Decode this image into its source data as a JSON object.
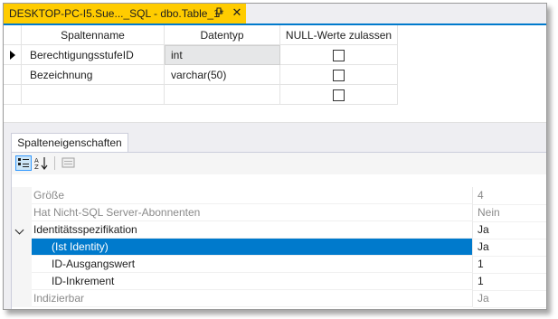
{
  "window": {
    "tab_title": "DESKTOP-PC-I5.Sue..._SQL - dbo.Table_1*",
    "close_glyph": "✕"
  },
  "grid": {
    "headers": [
      "Spaltenname",
      "Datentyp",
      "NULL-Werte zulassen"
    ],
    "rows": [
      {
        "name": "BerechtigungsstufeID",
        "type": "int",
        "allow_null": false,
        "current": true
      },
      {
        "name": "Bezeichnung",
        "type": "varchar(50)",
        "allow_null": false,
        "current": false
      },
      {
        "name": "",
        "type": "",
        "allow_null": false,
        "current": false
      }
    ]
  },
  "properties": {
    "tab_label": "Spalteneigenschaften",
    "toolbar": {
      "categorized_icon": "categorized-icon",
      "alphabetical_icon": "sort-az-icon",
      "pages_icon": "property-pages-icon"
    },
    "rows": [
      {
        "name": "Größe",
        "value": "4",
        "muted": true,
        "level": 0
      },
      {
        "name": "Hat Nicht-SQL Server-Abonnenten",
        "value": "Nein",
        "muted": true,
        "level": 0
      },
      {
        "name": "Identitätsspezifikation",
        "value": "Ja",
        "muted": false,
        "level": 0,
        "expanded": true
      },
      {
        "name": "(Ist Identity)",
        "value": "Ja",
        "muted": false,
        "level": 1,
        "selected": true
      },
      {
        "name": "ID-Ausgangswert",
        "value": "1",
        "muted": false,
        "level": 1
      },
      {
        "name": "ID-Inkrement",
        "value": "1",
        "muted": false,
        "level": 1
      },
      {
        "name": "Indizierbar",
        "value": "Ja",
        "muted": true,
        "level": 0
      }
    ]
  },
  "colors": {
    "tab_active": "#ffcc00",
    "accent": "#007acc",
    "selection": "#007acc",
    "muted_text": "#8a8a8a"
  }
}
